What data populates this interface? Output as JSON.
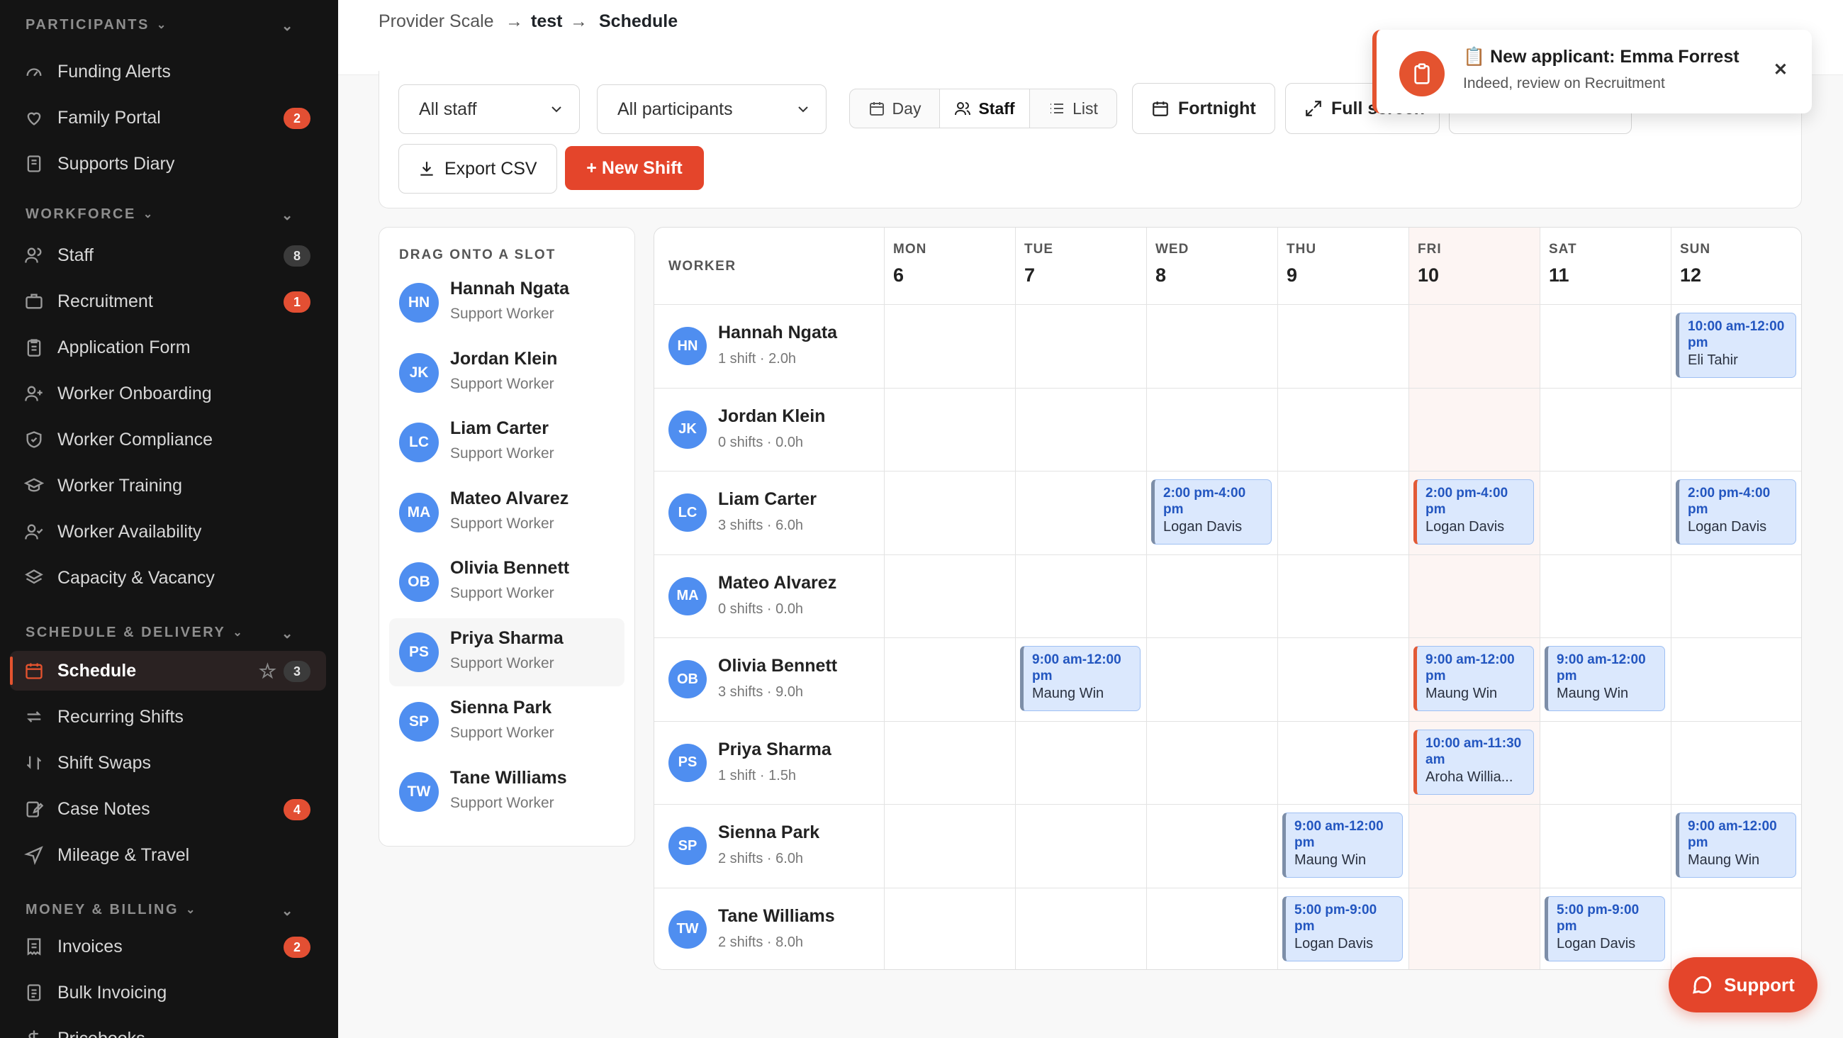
{
  "sidebar": {
    "sections": [
      {
        "title": "PARTICIPANTS",
        "items": [
          {
            "label": "Funding Alerts",
            "icon": "gauge-icon"
          },
          {
            "label": "Family Portal",
            "icon": "heart-hand-icon",
            "badge": "2"
          },
          {
            "label": "Supports Diary",
            "icon": "notebook-icon"
          }
        ]
      },
      {
        "title": "WORKFORCE",
        "items": [
          {
            "label": "Staff",
            "icon": "users-icon",
            "badge": "8"
          },
          {
            "label": "Recruitment",
            "icon": "briefcase-icon",
            "badge": "1"
          },
          {
            "label": "Application Form",
            "icon": "clipboard-icon"
          },
          {
            "label": "Worker Onboarding",
            "icon": "user-plus-icon"
          },
          {
            "label": "Worker Compliance",
            "icon": "shield-check-icon"
          },
          {
            "label": "Worker Training",
            "icon": "graduation-cap-icon"
          },
          {
            "label": "Worker Availability",
            "icon": "user-check-icon"
          },
          {
            "label": "Capacity & Vacancy",
            "icon": "layers-icon"
          }
        ]
      },
      {
        "title": "SCHEDULE & DELIVERY",
        "items": [
          {
            "label": "Schedule",
            "icon": "calendar-icon",
            "badge": "3",
            "active": true
          },
          {
            "label": "Recurring Shifts",
            "icon": "repeat-icon"
          },
          {
            "label": "Shift Swaps",
            "icon": "swap-icon"
          },
          {
            "label": "Case Notes",
            "icon": "edit-note-icon",
            "badge": "4"
          },
          {
            "label": "Mileage & Travel",
            "icon": "navigation-icon"
          }
        ]
      },
      {
        "title": "MONEY & BILLING",
        "items": [
          {
            "label": "Invoices",
            "icon": "receipt-icon",
            "badge": "2"
          },
          {
            "label": "Bulk Invoicing",
            "icon": "file-stack-icon"
          },
          {
            "label": "Pricebooks",
            "icon": "dollar-icon"
          }
        ]
      }
    ]
  },
  "breadcrumb": {
    "root": "Provider Scale",
    "org": "test",
    "page": "Schedule"
  },
  "toolbar": {
    "staff_filter": "All staff",
    "participant_filter": "All participants",
    "view_day": "Day",
    "view_staff": "Staff",
    "view_list": "List",
    "period": "Fortnight",
    "fullscreen": "Full screen",
    "export": "Export CSV",
    "new_shift": "+ New Shift"
  },
  "drag_panel": {
    "title": "DRAG ONTO A SLOT",
    "workers": [
      {
        "initials": "HN",
        "name": "Hannah Ngata",
        "role": "Support Worker"
      },
      {
        "initials": "JK",
        "name": "Jordan Klein",
        "role": "Support Worker"
      },
      {
        "initials": "LC",
        "name": "Liam Carter",
        "role": "Support Worker"
      },
      {
        "initials": "MA",
        "name": "Mateo Alvarez",
        "role": "Support Worker"
      },
      {
        "initials": "OB",
        "name": "Olivia Bennett",
        "role": "Support Worker"
      },
      {
        "initials": "PS",
        "name": "Priya Sharma",
        "role": "Support Worker"
      },
      {
        "initials": "SP",
        "name": "Sienna Park",
        "role": "Support Worker"
      },
      {
        "initials": "TW",
        "name": "Tane Williams",
        "role": "Support Worker"
      }
    ]
  },
  "grid": {
    "worker_header": "WORKER",
    "days": [
      {
        "name": "MON",
        "date": "6"
      },
      {
        "name": "TUE",
        "date": "7"
      },
      {
        "name": "WED",
        "date": "8"
      },
      {
        "name": "THU",
        "date": "9"
      },
      {
        "name": "FRI",
        "date": "10"
      },
      {
        "name": "SAT",
        "date": "11"
      },
      {
        "name": "SUN",
        "date": "12"
      }
    ],
    "rows": [
      {
        "initials": "HN",
        "name": "Hannah Ngata",
        "meta": "1 shift · 2.0h",
        "shifts": [
          {
            "day": 6,
            "time": "10:00 am-12:00 pm",
            "participant": "Eli Tahir"
          }
        ]
      },
      {
        "initials": "JK",
        "name": "Jordan Klein",
        "meta": "0 shifts · 0.0h",
        "shifts": []
      },
      {
        "initials": "LC",
        "name": "Liam Carter",
        "meta": "3 shifts · 6.0h",
        "shifts": [
          {
            "day": 2,
            "time": "2:00 pm-4:00 pm",
            "participant": "Logan Davis"
          },
          {
            "day": 4,
            "time": "2:00 pm-4:00 pm",
            "participant": "Logan Davis"
          },
          {
            "day": 6,
            "time": "2:00 pm-4:00 pm",
            "participant": "Logan Davis"
          }
        ]
      },
      {
        "initials": "MA",
        "name": "Mateo Alvarez",
        "meta": "0 shifts · 0.0h",
        "shifts": []
      },
      {
        "initials": "OB",
        "name": "Olivia Bennett",
        "meta": "3 shifts · 9.0h",
        "shifts": [
          {
            "day": 1,
            "time": "9:00 am-12:00 pm",
            "participant": "Maung Win"
          },
          {
            "day": 4,
            "time": "9:00 am-12:00 pm",
            "participant": "Maung Win"
          },
          {
            "day": 5,
            "time": "9:00 am-12:00 pm",
            "participant": "Maung Win"
          }
        ]
      },
      {
        "initials": "PS",
        "name": "Priya Sharma",
        "meta": "1 shift · 1.5h",
        "shifts": [
          {
            "day": 4,
            "time": "10:00 am-11:30 am",
            "participant": "Aroha Willia..."
          }
        ]
      },
      {
        "initials": "SP",
        "name": "Sienna Park",
        "meta": "2 shifts · 6.0h",
        "shifts": [
          {
            "day": 3,
            "time": "9:00 am-12:00 pm",
            "participant": "Maung Win"
          },
          {
            "day": 6,
            "time": "9:00 am-12:00 pm",
            "participant": "Maung Win"
          }
        ]
      },
      {
        "initials": "TW",
        "name": "Tane Williams",
        "meta": "2 shifts · 8.0h",
        "shifts": [
          {
            "day": 3,
            "time": "5:00 pm-9:00 pm",
            "participant": "Logan Davis"
          },
          {
            "day": 5,
            "time": "5:00 pm-9:00 pm",
            "participant": "Logan Davis"
          }
        ]
      }
    ]
  },
  "toast": {
    "title": "📋 New applicant: Emma Forrest",
    "subtitle": "Indeed, review on Recruitment"
  },
  "support_button": "Support",
  "colors": {
    "accent": "#e4532f",
    "avatar": "#4f8ef0",
    "shift_bg": "#dbe8fd",
    "shift_text": "#2356c0",
    "sidebar_bg": "#141414"
  }
}
